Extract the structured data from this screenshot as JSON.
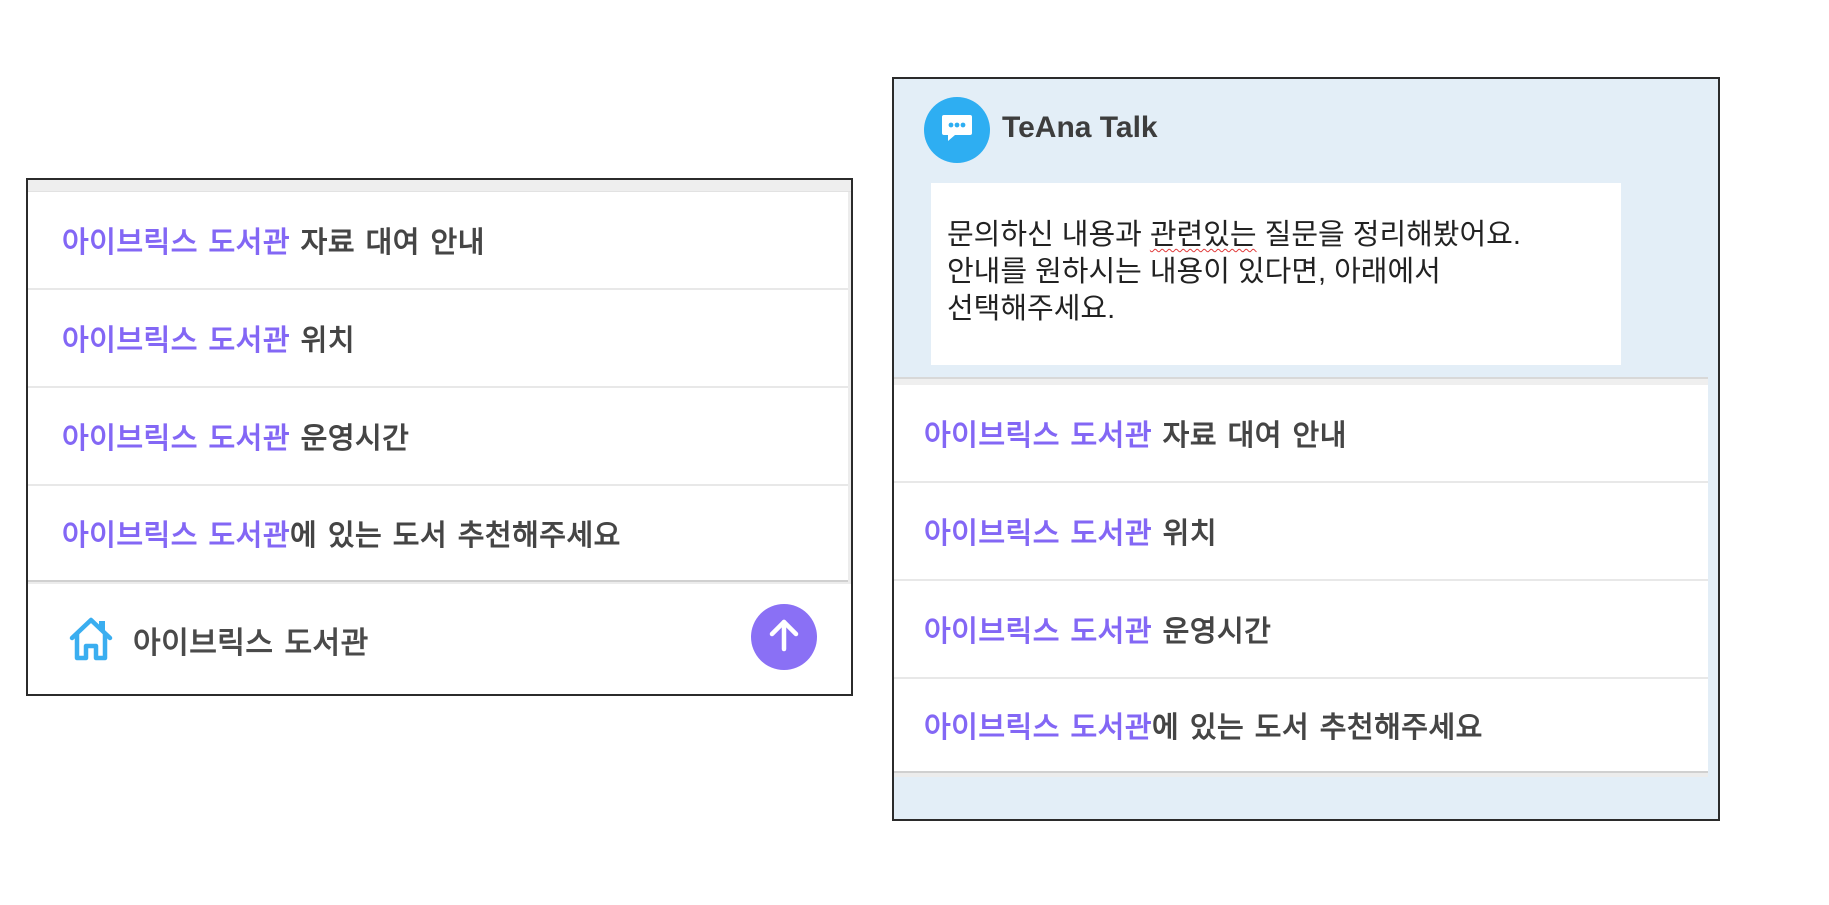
{
  "left_panel": {
    "items": [
      {
        "keyword": "아이브릭스 도서관",
        "rest": " 자료 대여 안내"
      },
      {
        "keyword": "아이브릭스 도서관",
        "rest": " 위치"
      },
      {
        "keyword": "아이브릭스 도서관",
        "rest": " 운영시간"
      },
      {
        "keyword": "아이브릭스 도서관",
        "rest": "에 있는 도서 추천해주세요"
      }
    ],
    "footer": {
      "home_icon": "home-icon",
      "label": "아이브릭스 도서관",
      "up_icon": "arrow-up-icon"
    }
  },
  "right_panel": {
    "bot": {
      "avatar_icon": "chat-bubble-icon",
      "name": "TeAna Talk"
    },
    "message": {
      "line1_a": "문의하신 내용과 ",
      "line1_squiggle": "관련있는",
      "line1_b": " 질문을 정리해봤어요.",
      "line2": "안내를 원하시는 내용이 있다면, 아래에서",
      "line3": "선택해주세요."
    },
    "items": [
      {
        "keyword": "아이브릭스 도서관",
        "rest": " 자료 대여 안내"
      },
      {
        "keyword": "아이브릭스 도서관",
        "rest": " 위치"
      },
      {
        "keyword": "아이브릭스 도서관",
        "rest": " 운영시간"
      },
      {
        "keyword": "아이브릭스 도서관",
        "rest": "에 있는 도서 추천해주세요"
      }
    ]
  },
  "colors": {
    "keyword": "#8367f5",
    "accent_button": "#8a70f5",
    "bot_avatar": "#2eaef2",
    "chat_background": "#e3eef7",
    "home_icon": "#3aaef0"
  }
}
